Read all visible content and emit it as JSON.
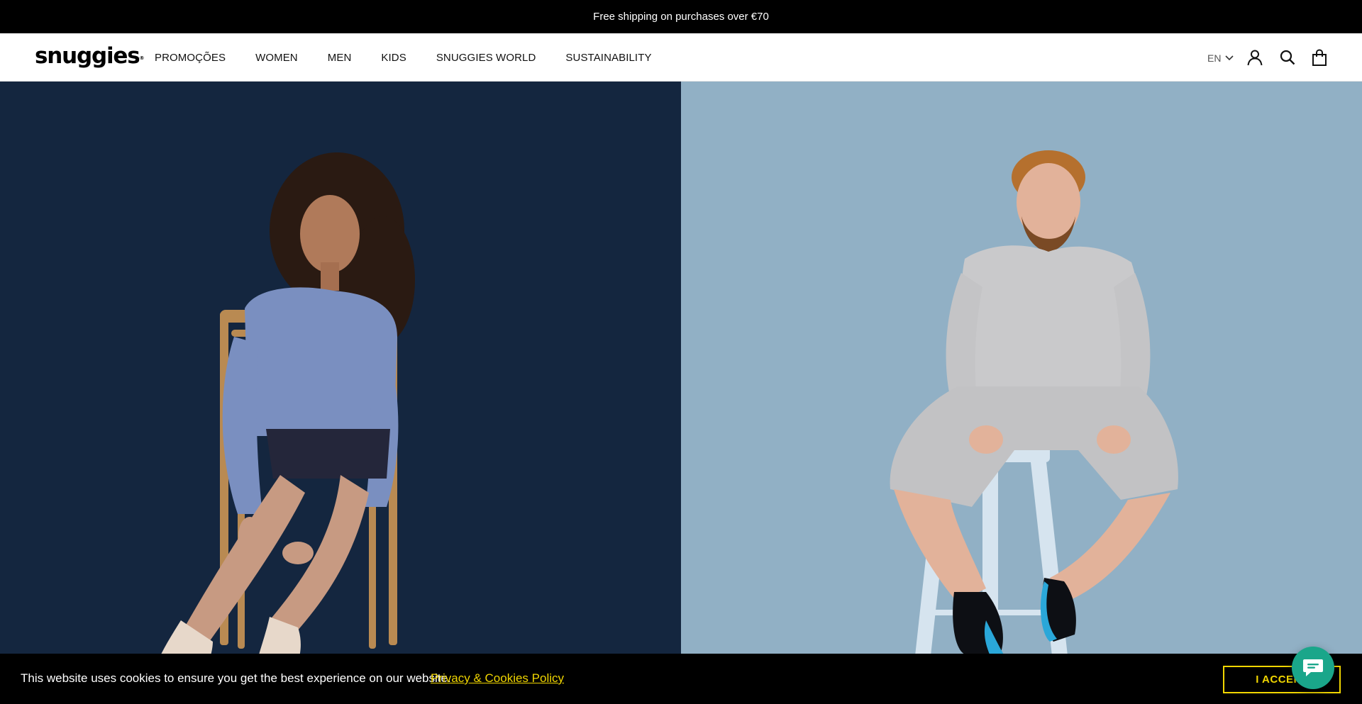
{
  "announcement": {
    "text": "Free shipping on purchases over €70"
  },
  "header": {
    "logo": "snuggies",
    "logo_mark": "®",
    "nav": [
      {
        "label": "PROMOÇÕES"
      },
      {
        "label": "WOMEN"
      },
      {
        "label": "MEN"
      },
      {
        "label": "KIDS"
      },
      {
        "label": "SNUGGIES WORLD"
      },
      {
        "label": "SUSTAINABILITY"
      }
    ],
    "language": "EN",
    "icons": [
      "account-icon",
      "search-icon",
      "cart-icon"
    ]
  },
  "hero": {
    "left": {
      "alt_subject": "woman sitting backwards on wooden chair wearing socks",
      "bg": "#14263f"
    },
    "right": {
      "alt_subject": "man sitting on metal stool wearing socks",
      "bg": "#91b0c5"
    }
  },
  "cookie": {
    "message": "This website uses cookies to ensure you get the best experience on our website.",
    "link": "Privacy & Cookies Policy",
    "accept": "I ACCEPT"
  },
  "colors": {
    "accent": "#f1d600",
    "chat": "#1aa68a",
    "topbar": "#000000"
  }
}
